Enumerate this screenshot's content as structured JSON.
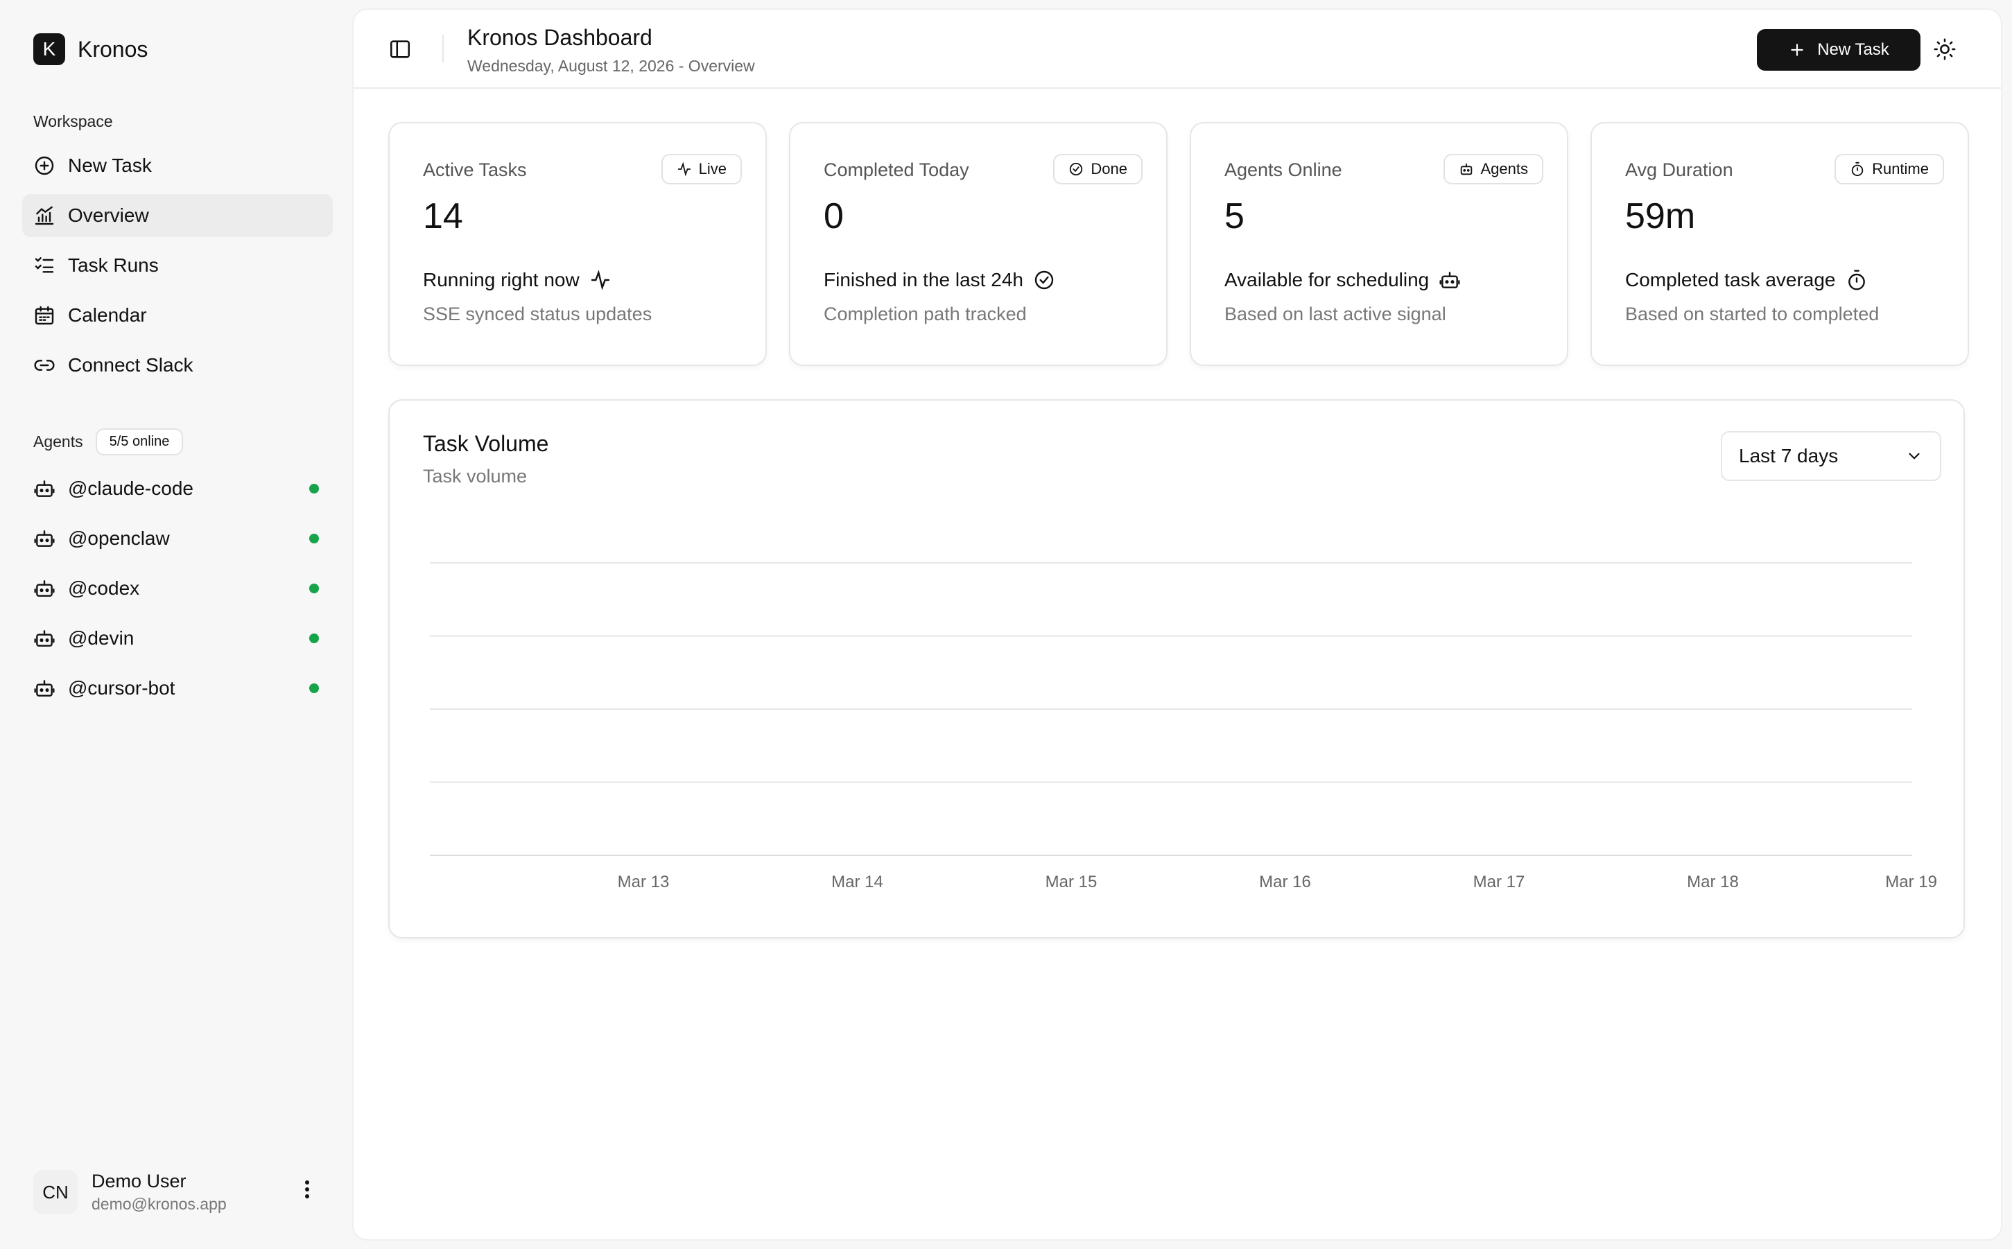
{
  "brand": {
    "logo_letter": "K",
    "name": "Kronos"
  },
  "sidebar": {
    "workspace_label": "Workspace",
    "nav": [
      {
        "label": "New Task",
        "icon": "plus-circle-icon"
      },
      {
        "label": "Overview",
        "icon": "chart-icon",
        "active": true
      },
      {
        "label": "Task Runs",
        "icon": "list-checks-icon"
      },
      {
        "label": "Calendar",
        "icon": "calendar-icon"
      },
      {
        "label": "Connect Slack",
        "icon": "link-icon"
      }
    ],
    "agents_label": "Agents",
    "agents_badge": "5/5 online",
    "agents": [
      {
        "name": "@claude-code",
        "status": "online"
      },
      {
        "name": "@openclaw",
        "status": "online"
      },
      {
        "name": "@codex",
        "status": "online"
      },
      {
        "name": "@devin",
        "status": "online"
      },
      {
        "name": "@cursor-bot",
        "status": "online"
      }
    ],
    "user": {
      "initials": "CN",
      "name": "Demo User",
      "email": "demo@kronos.app"
    }
  },
  "header": {
    "title": "Kronos Dashboard",
    "subtitle": "Wednesday, August 12, 2026 - Overview",
    "new_task_label": "New Task"
  },
  "stats": [
    {
      "label": "Active Tasks",
      "badge": "Live",
      "badge_icon": "activity-icon",
      "value": "14",
      "desc": "Running right now",
      "desc_icon": "activity-icon",
      "note": "SSE synced status updates"
    },
    {
      "label": "Completed Today",
      "badge": "Done",
      "badge_icon": "check-circle-icon",
      "value": "0",
      "desc": "Finished in the last 24h",
      "desc_icon": "check-circle-icon",
      "note": "Completion path tracked"
    },
    {
      "label": "Agents Online",
      "badge": "Agents",
      "badge_icon": "bot-icon",
      "value": "5",
      "desc": "Available for scheduling",
      "desc_icon": "bot-icon",
      "note": "Based on last active signal"
    },
    {
      "label": "Avg Duration",
      "badge": "Runtime",
      "badge_icon": "timer-icon",
      "value": "59m",
      "desc": "Completed task average",
      "desc_icon": "timer-icon",
      "note": "Based on started to completed"
    }
  ],
  "chart": {
    "title": "Task Volume",
    "subtitle": "Task volume",
    "range_label": "Last 7 days"
  },
  "colors": {
    "accent": "#141414",
    "online": "#16a34a",
    "grid": "#e6e6e6"
  },
  "chart_data": {
    "type": "area",
    "categories": [
      "Mar 13",
      "Mar 14",
      "Mar 15",
      "Mar 16",
      "Mar 17",
      "Mar 18",
      "Mar 19"
    ],
    "series": [],
    "grid": true
  }
}
